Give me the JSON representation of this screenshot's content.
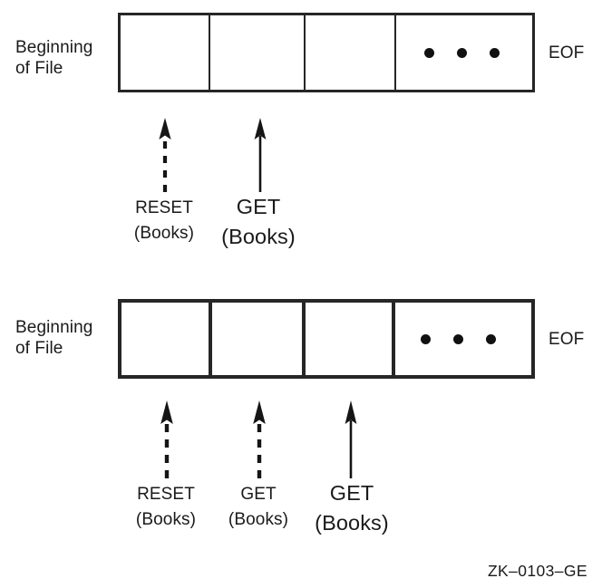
{
  "figure": {
    "code": "ZK–0103–GE",
    "colors": {
      "line": "#262626",
      "ink": "#1a1a1a",
      "dot": "#111111",
      "background": "#ffffff"
    }
  },
  "diagrams": [
    {
      "id": "top",
      "start_label": "Beginning\nof File",
      "end_label": "EOF",
      "cells": [
        {
          "name": "record-cell-1",
          "content": ""
        },
        {
          "name": "record-cell-2",
          "content": ""
        },
        {
          "name": "record-cell-3",
          "content": ""
        },
        {
          "name": "record-cell-ellipsis",
          "content": "• • •"
        }
      ],
      "pointers": [
        {
          "operation": "RESET",
          "argument": "(Books)",
          "style": "dashed",
          "emphasis": "normal"
        },
        {
          "operation": "GET",
          "argument": "(Books)",
          "style": "solid",
          "emphasis": "large"
        }
      ]
    },
    {
      "id": "bottom",
      "start_label": "Beginning\nof File",
      "end_label": "EOF",
      "cells": [
        {
          "name": "record-cell-1",
          "content": ""
        },
        {
          "name": "record-cell-2",
          "content": ""
        },
        {
          "name": "record-cell-3",
          "content": ""
        },
        {
          "name": "record-cell-ellipsis",
          "content": "• • •"
        }
      ],
      "pointers": [
        {
          "operation": "RESET",
          "argument": "(Books)",
          "style": "dashed",
          "emphasis": "normal"
        },
        {
          "operation": "GET",
          "argument": "(Books)",
          "style": "dashed",
          "emphasis": "normal"
        },
        {
          "operation": "GET",
          "argument": "(Books)",
          "style": "solid",
          "emphasis": "large"
        }
      ]
    }
  ]
}
